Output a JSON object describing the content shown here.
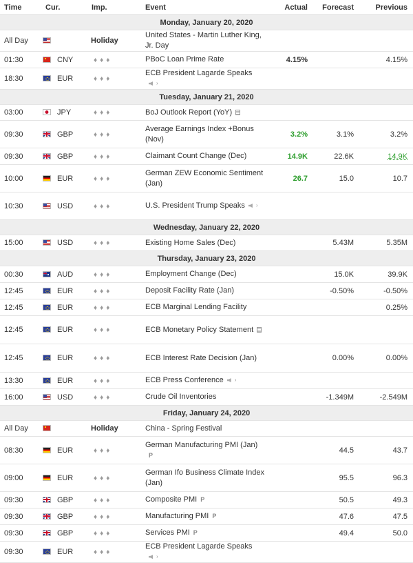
{
  "header": {
    "time": "Time",
    "cur": "Cur.",
    "imp": "Imp.",
    "event": "Event",
    "actual": "Actual",
    "forecast": "Forecast",
    "previous": "Previous"
  },
  "colors": {
    "actual_better": "#2e9e2e",
    "day_header_bg": "#eeeeee",
    "border": "#e4e4e4"
  },
  "days": [
    {
      "label": "Monday, January 20, 2020",
      "events": [
        {
          "time": "All Day",
          "flag": "US",
          "cur": "",
          "imp": "Holiday",
          "event": "United States - Martin Luther King, Jr. Day",
          "actual": "",
          "forecast": "",
          "previous": ""
        },
        {
          "time": "01:30",
          "flag": "CN",
          "cur": "CNY",
          "imp": "",
          "event": "PBoC Loan Prime Rate",
          "actual": "4.15%",
          "forecast": "",
          "previous": "4.15%"
        },
        {
          "time": "18:30",
          "flag": "EU",
          "cur": "EUR",
          "imp": "",
          "event": "ECB President Lagarde Speaks",
          "icon": "speaker-icon",
          "actual": "",
          "forecast": "",
          "previous": ""
        }
      ]
    },
    {
      "label": "Tuesday, January 21, 2020",
      "events": [
        {
          "time": "03:00",
          "flag": "JP",
          "cur": "JPY",
          "imp": "",
          "event": "BoJ Outlook Report (YoY)",
          "icon": "document-icon",
          "actual": "",
          "forecast": "",
          "previous": ""
        },
        {
          "time": "09:30",
          "flag": "GB",
          "cur": "GBP",
          "imp": "",
          "event": "Average Earnings Index +Bonus (Nov)",
          "actual": "3.2%",
          "actual_color": "green",
          "forecast": "3.1%",
          "previous": "3.2%"
        },
        {
          "time": "09:30",
          "flag": "GB",
          "cur": "GBP",
          "imp": "",
          "event": "Claimant Count Change (Dec)",
          "actual": "14.9K",
          "actual_color": "green",
          "forecast": "22.6K",
          "previous": "14.9K",
          "previous_color": "green"
        },
        {
          "time": "10:00",
          "flag": "DE",
          "cur": "EUR",
          "imp": "",
          "event": "German ZEW Economic Sentiment (Jan)",
          "actual": "26.7",
          "actual_color": "green",
          "forecast": "15.0",
          "previous": "10.7"
        },
        {
          "time": "10:30",
          "flag": "US",
          "cur": "USD",
          "imp": "",
          "event": "U.S. President Trump Speaks",
          "icon": "speaker-icon",
          "actual": "",
          "forecast": "",
          "previous": ""
        }
      ]
    },
    {
      "label": "Wednesday, January 22, 2020",
      "events": [
        {
          "time": "15:00",
          "flag": "US",
          "cur": "USD",
          "imp": "",
          "event": "Existing Home Sales (Dec)",
          "actual": "",
          "forecast": "5.43M",
          "previous": "5.35M"
        }
      ]
    },
    {
      "label": "Thursday, January 23, 2020",
      "events": [
        {
          "time": "00:30",
          "flag": "AU",
          "cur": "AUD",
          "imp": "",
          "event": "Employment Change (Dec)",
          "actual": "",
          "forecast": "15.0K",
          "previous": "39.9K"
        },
        {
          "time": "12:45",
          "flag": "EU",
          "cur": "EUR",
          "imp": "",
          "event": "Deposit Facility Rate (Jan)",
          "actual": "",
          "forecast": "-0.50%",
          "previous": "-0.50%"
        },
        {
          "time": "12:45",
          "flag": "EU",
          "cur": "EUR",
          "imp": "",
          "event": "ECB Marginal Lending Facility",
          "actual": "",
          "forecast": "",
          "previous": "0.25%"
        },
        {
          "time": "12:45",
          "flag": "EU",
          "cur": "EUR",
          "imp": "",
          "event": "ECB Monetary Policy Statement",
          "icon": "document-icon",
          "actual": "",
          "forecast": "",
          "previous": ""
        },
        {
          "time": "12:45",
          "flag": "EU",
          "cur": "EUR",
          "imp": "",
          "event": "ECB Interest Rate Decision (Jan)",
          "actual": "",
          "forecast": "0.00%",
          "previous": "0.00%"
        },
        {
          "time": "13:30",
          "flag": "EU",
          "cur": "EUR",
          "imp": "",
          "event": "ECB Press Conference",
          "icon": "speaker-icon",
          "actual": "",
          "forecast": "",
          "previous": ""
        },
        {
          "time": "16:00",
          "flag": "US",
          "cur": "USD",
          "imp": "",
          "event": "Crude Oil Inventories",
          "actual": "",
          "forecast": "-1.349M",
          "previous": "-2.549M"
        }
      ]
    },
    {
      "label": "Friday, January 24, 2020",
      "events": [
        {
          "time": "All Day",
          "flag": "CN",
          "cur": "",
          "imp": "Holiday",
          "event": "China - Spring Festival",
          "actual": "",
          "forecast": "",
          "previous": ""
        },
        {
          "time": "08:30",
          "flag": "DE",
          "cur": "EUR",
          "imp": "",
          "event": "German Manufacturing PMI (Jan)",
          "icon": "preliminary-icon",
          "icon_text": "P",
          "actual": "",
          "forecast": "44.5",
          "previous": "43.7"
        },
        {
          "time": "09:00",
          "flag": "DE",
          "cur": "EUR",
          "imp": "",
          "event": "German Ifo Business Climate Index (Jan)",
          "actual": "",
          "forecast": "95.5",
          "previous": "96.3"
        },
        {
          "time": "09:30",
          "flag": "GB",
          "cur": "GBP",
          "imp": "",
          "event": "Composite PMI",
          "icon": "preliminary-icon",
          "icon_text": "P",
          "actual": "",
          "forecast": "50.5",
          "previous": "49.3"
        },
        {
          "time": "09:30",
          "flag": "GB",
          "cur": "GBP",
          "imp": "",
          "event": "Manufacturing PMI",
          "icon": "preliminary-icon",
          "icon_text": "P",
          "actual": "",
          "forecast": "47.6",
          "previous": "47.5"
        },
        {
          "time": "09:30",
          "flag": "GB",
          "cur": "GBP",
          "imp": "",
          "event": "Services PMI",
          "icon": "preliminary-icon",
          "icon_text": "P",
          "actual": "",
          "forecast": "49.4",
          "previous": "50.0"
        },
        {
          "time": "09:30",
          "flag": "EU",
          "cur": "EUR",
          "imp": "",
          "event": "ECB President Lagarde Speaks",
          "icon": "speaker-icon",
          "actual": "",
          "forecast": "",
          "previous": ""
        }
      ]
    }
  ]
}
